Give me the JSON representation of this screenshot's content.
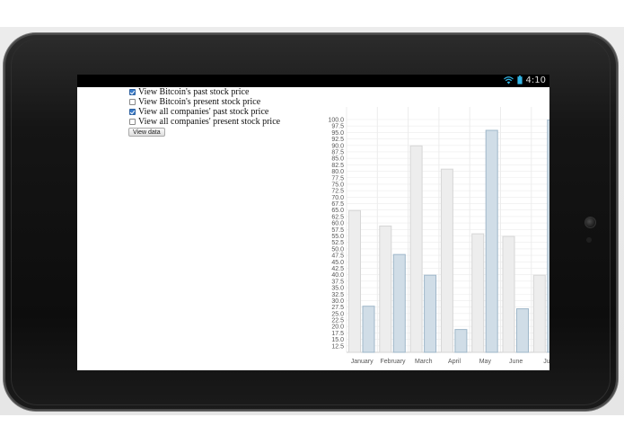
{
  "status_bar": {
    "time": "4:10",
    "wifi_icon": "wifi-icon",
    "battery_icon": "battery-icon"
  },
  "form": {
    "options": [
      {
        "label": "View Bitcoin's past stock price",
        "checked": true
      },
      {
        "label": "View Bitcoin's present stock price",
        "checked": false
      },
      {
        "label": "View all companies' past stock price",
        "checked": true
      },
      {
        "label": "View all companies' present stock price",
        "checked": false
      }
    ],
    "view_button_label": "View data"
  },
  "colors": {
    "series_1_fill": "#ededed",
    "series_1_stroke": "#d6d6d6",
    "series_2_fill": "#d0dde7",
    "series_2_stroke": "#9fb7c9",
    "grid": "#ececec"
  },
  "chart_data": {
    "type": "bar",
    "categories": [
      "January",
      "February",
      "March",
      "April",
      "May",
      "June",
      "July"
    ],
    "category_labels": [
      "January",
      "February",
      "March",
      "April",
      "May",
      "June",
      "Ju"
    ],
    "series": [
      {
        "values": [
          65,
          59,
          90,
          81,
          56,
          55,
          40
        ]
      },
      {
        "values": [
          28,
          48,
          40,
          19,
          96,
          27,
          100
        ]
      }
    ],
    "ylim": [
      10,
      100
    ],
    "y_tick_step": 2.5,
    "y_tick_labels": [
      "100.0",
      "97.5",
      "95.0",
      "92.5",
      "90.0",
      "87.5",
      "85.0",
      "82.5",
      "80.0",
      "77.5",
      "75.0",
      "72.5",
      "70.0",
      "67.5",
      "65.0",
      "62.5",
      "60.0",
      "57.5",
      "55.0",
      "52.5",
      "50.0",
      "47.5",
      "45.0",
      "42.5",
      "40.0",
      "37.5",
      "35.0",
      "32.5",
      "30.0",
      "27.5",
      "25.0",
      "22.5",
      "20.0",
      "17.5",
      "15.0",
      "12.5"
    ],
    "grid": true,
    "title": "",
    "xlabel": "",
    "ylabel": ""
  }
}
